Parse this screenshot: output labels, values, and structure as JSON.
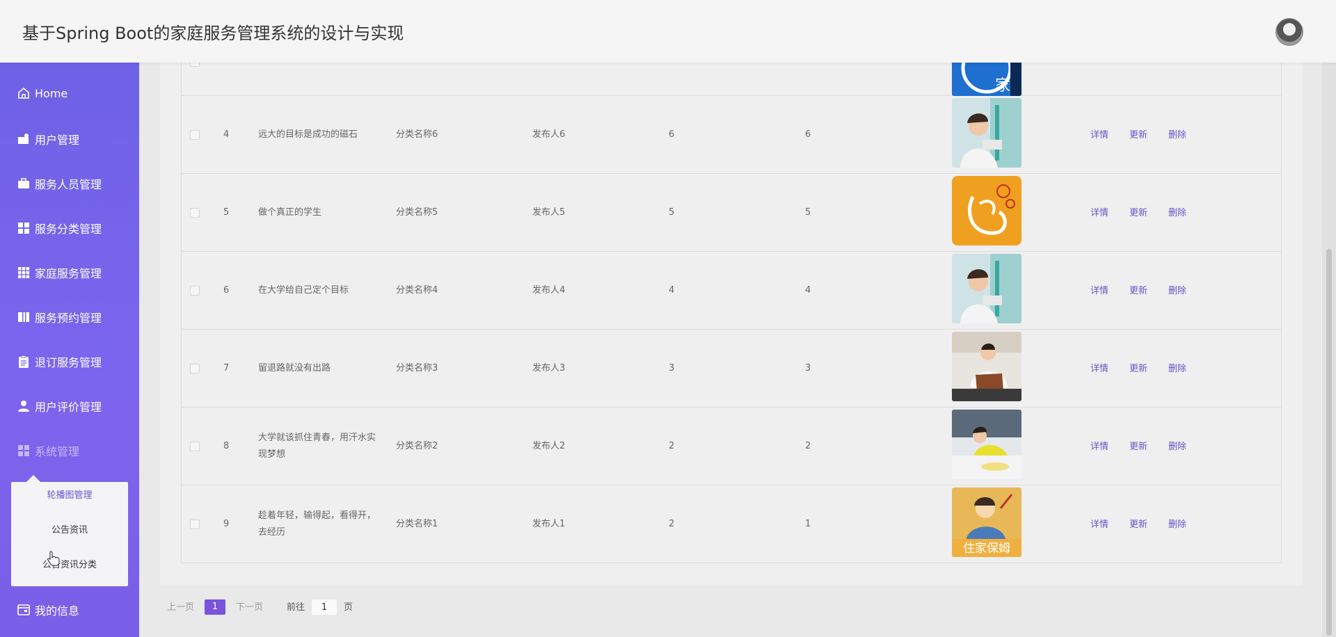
{
  "header": {
    "title": "基于Spring Boot的家庭服务管理系统的设计与实现",
    "avatar_icon": "avatar-icon"
  },
  "sidebar": {
    "items": [
      {
        "label": "Home",
        "icon": "home-icon"
      },
      {
        "label": "用户管理",
        "icon": "user-manage-icon"
      },
      {
        "label": "服务人员管理",
        "icon": "briefcase-icon"
      },
      {
        "label": "服务分类管理",
        "icon": "grid-icon"
      },
      {
        "label": "家庭服务管理",
        "icon": "grid9-icon"
      },
      {
        "label": "服务预约管理",
        "icon": "book-icon"
      },
      {
        "label": "退订服务管理",
        "icon": "clipboard-icon"
      },
      {
        "label": "用户评价管理",
        "icon": "person-icon"
      },
      {
        "label": "系统管理",
        "icon": "grid-icon"
      },
      {
        "label": "我的信息",
        "icon": "card-icon"
      }
    ],
    "submenu": [
      {
        "label": "轮播图管理"
      },
      {
        "label": "公告资讯"
      },
      {
        "label": "公告资讯分类"
      }
    ]
  },
  "table": {
    "rows": [
      {
        "index": "4",
        "title": "远大的目标是成功的磁石",
        "category": "分类名称6",
        "publisher": "发布人6",
        "col5": "6",
        "col6": "6",
        "image": "worker-cleaning-window"
      },
      {
        "index": "5",
        "title": "做个真正的学生",
        "category": "分类名称5",
        "publisher": "发布人5",
        "col5": "5",
        "col6": "5",
        "image": "housekeeping-logo"
      },
      {
        "index": "6",
        "title": "在大学给自己定个目标",
        "category": "分类名称4",
        "publisher": "发布人4",
        "col5": "4",
        "col6": "4",
        "image": "worker-cleaning-window"
      },
      {
        "index": "7",
        "title": "留退路就没有出路",
        "category": "分类名称3",
        "publisher": "发布人3",
        "col5": "3",
        "col6": "3",
        "image": "worker-ironing"
      },
      {
        "index": "8",
        "title": "大学就该抓住青春，用汗水实现梦想",
        "category": "分类名称2",
        "publisher": "发布人2",
        "col5": "2",
        "col6": "2",
        "image": "worker-wiping-table"
      },
      {
        "index": "9",
        "title": "趁着年轻，输得起，看得开，去经历",
        "category": "分类名称1",
        "publisher": "发布人1",
        "col5": "2",
        "col6": "1",
        "image": "nanny-cartoon"
      }
    ],
    "actions": {
      "detail": "详情",
      "update": "更新",
      "delete": "删除"
    },
    "nanny_badge_text": "住家保姆",
    "logo_text": "家政"
  },
  "pagination": {
    "prev": "上一页",
    "current": "1",
    "next": "下一页",
    "goto_label": "前往",
    "goto_value": "1",
    "page_unit": "页"
  },
  "colors": {
    "sidebar": "#7563ea",
    "accent": "#7a52dc",
    "action": "#6a55c9"
  }
}
